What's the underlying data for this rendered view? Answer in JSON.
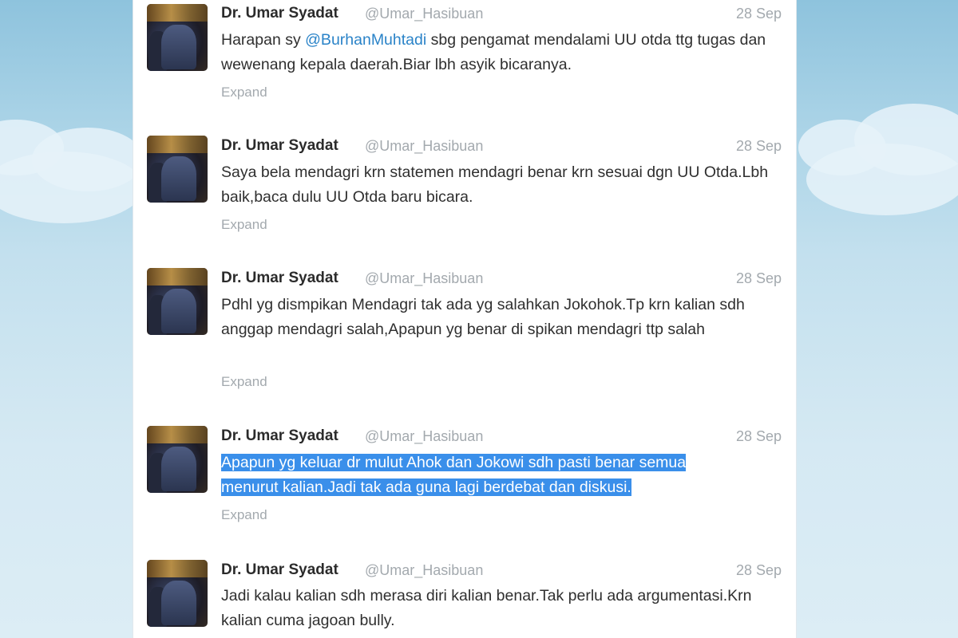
{
  "tweets": [
    {
      "author": "Dr. Umar Syadat",
      "username": "@Umar_Hasibuan",
      "time": "28 Sep",
      "text_before": "Harapan sy ",
      "mention": "@BurhanMuhtadi",
      "text_after": " sbg pengamat mendalami UU otda ttg tugas dan wewenang kepala daerah.Biar lbh asyik bicaranya.",
      "expand": "Expand"
    },
    {
      "author": "Dr. Umar Syadat",
      "username": "@Umar_Hasibuan",
      "time": "28 Sep",
      "text": "Saya bela mendagri krn statemen mendagri benar krn sesuai dgn UU Otda.Lbh baik,baca dulu UU Otda baru bicara.",
      "expand": "Expand"
    },
    {
      "author": "Dr. Umar Syadat",
      "username": "@Umar_Hasibuan",
      "time": "28 Sep",
      "text": "Pdhl yg dismpikan Mendagri tak ada yg salahkan Jokohok.Tp krn kalian sdh anggap mendagri salah,Apapun yg benar di spikan mendagri ttp salah",
      "expand": "Expand"
    },
    {
      "author": "Dr. Umar Syadat",
      "username": "@Umar_Hasibuan",
      "time": "28 Sep",
      "text_line1": "Apapun yg keluar dr mulut Ahok dan Jokowi sdh pasti benar semua",
      "text_line2": "menurut kalian.Jadi tak ada guna lagi berdebat dan diskusi.",
      "expand": "Expand"
    },
    {
      "author": "Dr. Umar Syadat",
      "username": "@Umar_Hasibuan",
      "time": "28 Sep",
      "text": "Jadi kalau kalian sdh merasa diri kalian benar.Tak perlu ada argumentasi.Krn kalian cuma jagoan bully."
    }
  ]
}
